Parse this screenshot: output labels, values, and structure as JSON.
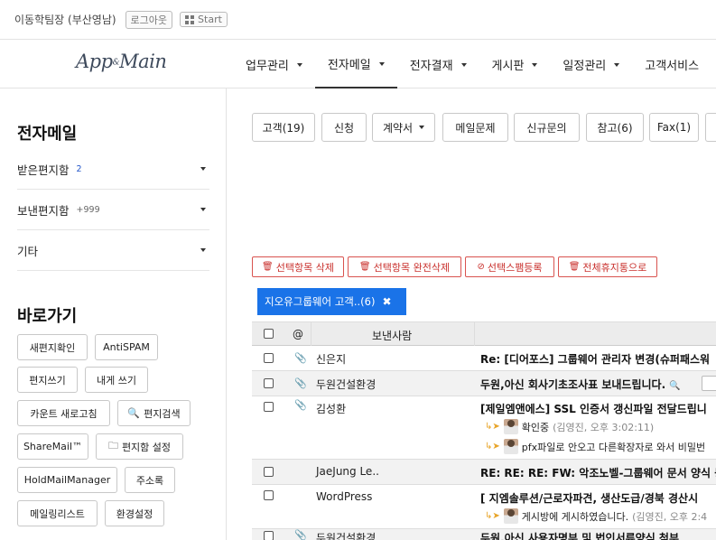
{
  "topbar": {
    "user": "이동학팀장 (부산영남)",
    "logout": "로그아웃",
    "start": "Start"
  },
  "logo": {
    "text": "App",
    "mid": "&",
    "text2": "Main"
  },
  "menu": [
    "업무관리",
    "전자메일",
    "전자결재",
    "게시판",
    "일정관리",
    "고객서비스"
  ],
  "sidebar": {
    "title": "전자메일",
    "folders": [
      {
        "label": "받은편지함",
        "count": "2"
      },
      {
        "label": "보낸편지함",
        "count": "+999"
      },
      {
        "label": "기타",
        "count": ""
      }
    ],
    "shortcut_title": "바로가기",
    "shortcuts": [
      "새편지확인",
      "AntiSPAM",
      "편지쓰기",
      "내게 쓰기",
      "카운트 새로고침",
      "편지검색",
      "ShareMail™",
      "편지함 설정",
      "HoldMailManager",
      "주소록",
      "메일링리스트",
      "환경설정"
    ]
  },
  "tabs": [
    "고객(19)",
    "신청",
    "계약서",
    "메일문제",
    "신규문의",
    "참고(6)",
    "Fax(1)"
  ],
  "actions": [
    "선택항목 삭제",
    "선택항목 완전삭제",
    "선택스팸등록",
    "전체휴지통으로"
  ],
  "filter_chip": "지오유그룹웨어 고객..(6)",
  "table": {
    "headers": {
      "attach": "@",
      "sender": "보낸사람"
    },
    "rows": [
      {
        "sender": "신은지",
        "subject": "Re: [디어포스] 그룹웨어 관리자 변경(슈퍼패스워"
      },
      {
        "sender": "두원건설환경",
        "subject": "두원,아신 회사기초조사표 보내드립니다."
      },
      {
        "sender": "김성환",
        "subject": "[제일엠앤에스] SSL 인증서 갱신파일 전달드립니",
        "replies": [
          {
            "name": "확인중",
            "meta": "(김영진, 오후 3:02:11)"
          },
          {
            "name": "pfx파일로 안오고 다른확장자로 와서 비밀번",
            "meta": ""
          }
        ]
      },
      {
        "sender": "JaeJung Le..",
        "subject": "RE: RE: RE: FW: 악조노벨-그룹웨어 문서 양식 등"
      },
      {
        "sender": "WordPress",
        "subject": "[ 지엠솔루션/근로자파견, 생산도급/경북 경산시",
        "replies": [
          {
            "name": "게시방에 게시하였습니다.",
            "meta": "(김영진, 오후 2:4"
          }
        ]
      },
      {
        "sender": "두원건설환경",
        "subject": "두원,아신 사용자명부 및 법인서류양식 첨부"
      }
    ]
  }
}
